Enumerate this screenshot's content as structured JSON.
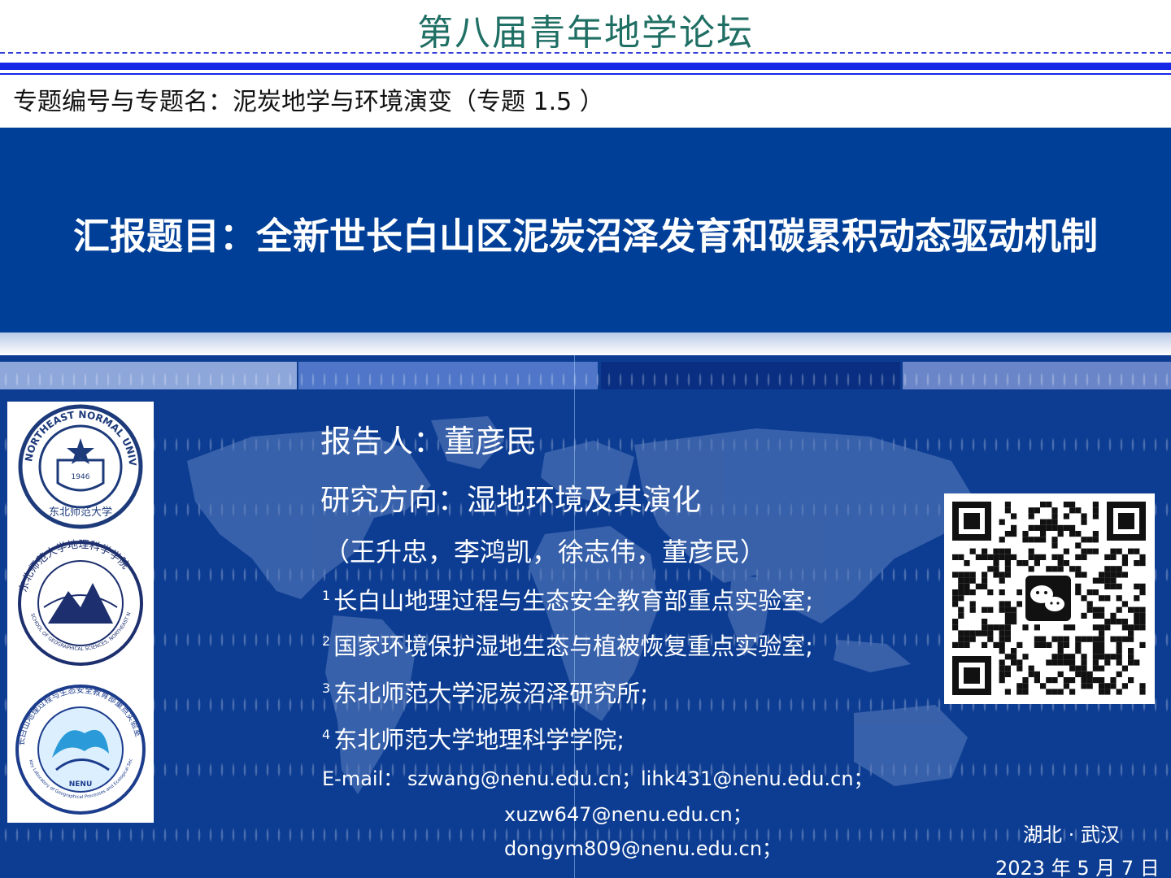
{
  "header": {
    "conference_title": "第八届青年地学论坛",
    "topic": "专题编号与专题名：泥炭地学与环境演变（专题 1.5 ）"
  },
  "title_band": {
    "report_title": "汇报题目：全新世长白山区泥炭沼泽发育和碳累积动态驱动机制"
  },
  "presenter": {
    "reporter": "报告人：董彦民",
    "research_direction": "研究方向：湿地环境及其演化",
    "authors": "（王升忠，李鸿凯，徐志伟，董彦民）",
    "affiliations": [
      {
        "num": "1",
        "text": "长白山地理过程与生态安全教育部重点实验室;"
      },
      {
        "num": "2",
        "text": "国家环境保护湿地生态与植被恢复重点实验室;"
      },
      {
        "num": "3",
        "text": "东北师范大学泥炭沼泽研究所;"
      },
      {
        "num": "4",
        "text": "东北师范大学地理科学学院;"
      }
    ],
    "email_label": "E-mail：",
    "emails": [
      "szwang@nenu.edu.cn；",
      "lihk431@nenu.edu.cn；",
      "xuzw647@nenu.edu.cn；",
      "dongym809@nenu.edu.cn；"
    ]
  },
  "logos": {
    "logo1_text": "NORTHEAST NORMAL UNIVERSITY",
    "logo1_year": "1946",
    "logo1_cn": "东北师范大学",
    "logo2_cn": "东北师范大学地理科学学院",
    "logo2_en": "SCHOOL OF GEOGRAPHICAL SCIENCES, NORTHEAST NORMAL UNIVERSITY",
    "logo3_cn": "长白山地理过程与生态安全教育部重点实验室",
    "logo3_en": "Key Laboratory of Geographical Processes and Ecological Security of Changbai Mountains, Ministry of Education",
    "logo3_label": "NENU"
  },
  "footer": {
    "place": "湖北 · 武汉",
    "date": "2023 年 5 月 7 日"
  },
  "colors": {
    "title_band": "#003f97",
    "lower_panel": "#0d3d92",
    "header_title": "#1f6f64",
    "rule": "#1428e6"
  },
  "icons": [
    "qr-code-icon",
    "wechat-icon",
    "world-map-icon"
  ]
}
